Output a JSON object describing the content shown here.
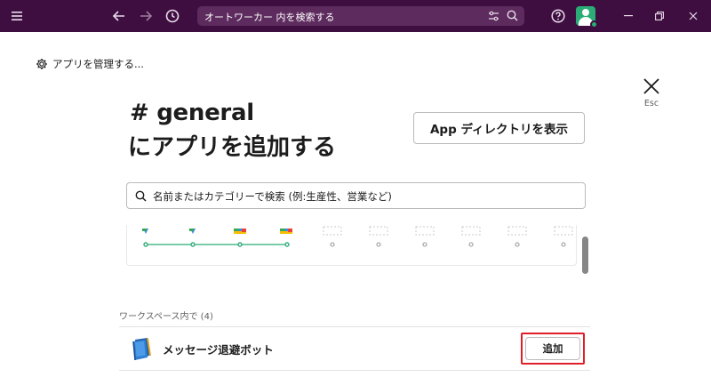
{
  "topbar": {
    "search_text": "オートワーカー 内を検索する",
    "icons": [
      "menu-icon",
      "back-arrow-icon",
      "forward-arrow-icon",
      "history-icon",
      "filter-icon",
      "search-icon",
      "help-icon",
      "avatar",
      "minimize-icon",
      "restore-icon",
      "close-icon"
    ]
  },
  "manage_link": {
    "label": "アプリを管理する..."
  },
  "close": {
    "esc_label": "Esc"
  },
  "header": {
    "channel": "# general",
    "title": "にアプリを追加する",
    "directory_button": "App ディレクトリを表示"
  },
  "app_search": {
    "placeholder": "名前またはカテゴリーで検索 (例:生産性、営業など)"
  },
  "section": {
    "label": "ワークスペース内で (4)",
    "apps": [
      {
        "name": "メッセージ退避ボット",
        "add_label": "追加"
      }
    ]
  },
  "colors": {
    "topbar": "#3f0e40",
    "accent_green": "#2bac76",
    "highlight_red": "#e01e2a"
  }
}
